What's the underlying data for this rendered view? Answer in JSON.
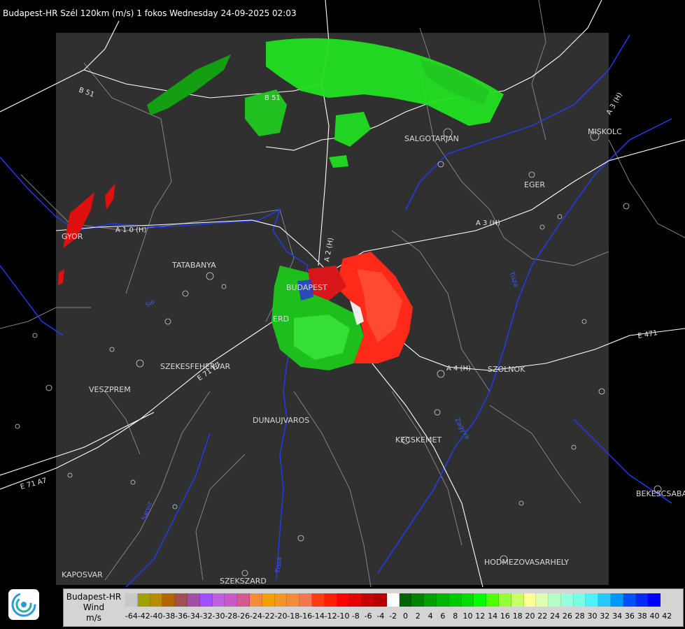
{
  "header": {
    "title": "Budapest-HR Szél 120km (m/s) 1 fokos Wednesday 24-09-2025 02:03"
  },
  "map": {
    "cities": [
      "SALGOTARJAN",
      "MISKOLC",
      "EGER",
      "TATABANYA",
      "BUDAPEST",
      "ERD",
      "SZEKESFEHERVAR",
      "VESZPREM",
      "SZOLNOK",
      "DUNAUJVAROS",
      "KECSKEMET",
      "BEKESCSABA",
      "HODMEZOVASARHELY",
      "KAPOSVAR",
      "SZEKSZARD",
      "GYOR"
    ],
    "roads": [
      "B 51",
      "B 51",
      "A 3 (H)",
      "A 3 (H)",
      "A 1 0 (H)",
      "A 2 (H)",
      "A 4 (H)",
      "E 471",
      "E 71 A7",
      "E 71 E7"
    ],
    "rivers": [
      "Tisza",
      "Sarviz",
      "Zagyva",
      "Tisza",
      "Sio"
    ]
  },
  "legend": {
    "station": "Budapest-HR",
    "quantity": "Wind",
    "unit": "m/s",
    "colors": [
      "#c8c8c8",
      "#a0a000",
      "#b48c00",
      "#b46400",
      "#a05050",
      "#a050a0",
      "#a050ff",
      "#c060e0",
      "#c85ac8",
      "#d25a8c",
      "#f08c3c",
      "#f0a000",
      "#f09628",
      "#f08c3c",
      "#f07850",
      "#ff3c14",
      "#ff1e00",
      "#ff0000",
      "#e60000",
      "#c80000",
      "#b40000",
      "#ffffff",
      "#006400",
      "#008200",
      "#00a000",
      "#00b400",
      "#00c800",
      "#00dc00",
      "#00ff00",
      "#50ff00",
      "#96ff3c",
      "#c8ff64",
      "#ffff96",
      "#dcffb4",
      "#b4ffc8",
      "#96ffdc",
      "#78ffe6",
      "#50f0ff",
      "#28c8ff",
      "#0096ff",
      "#0050ff",
      "#0028ff",
      "#0000ff"
    ],
    "ticks": [
      "-64",
      "-42",
      "-40",
      "-38",
      "-36",
      "-34",
      "-32",
      "-30",
      "-28",
      "-26",
      "-24",
      "-22",
      "-20",
      "-18",
      "-16",
      "-14",
      "-12",
      "-10",
      "-8",
      "-6",
      "-4",
      "-2",
      "0",
      "2",
      "4",
      "6",
      "8",
      "10",
      "12",
      "14",
      "16",
      "18",
      "20",
      "22",
      "24",
      "26",
      "28",
      "30",
      "32",
      "34",
      "36",
      "38",
      "40",
      "42"
    ]
  }
}
